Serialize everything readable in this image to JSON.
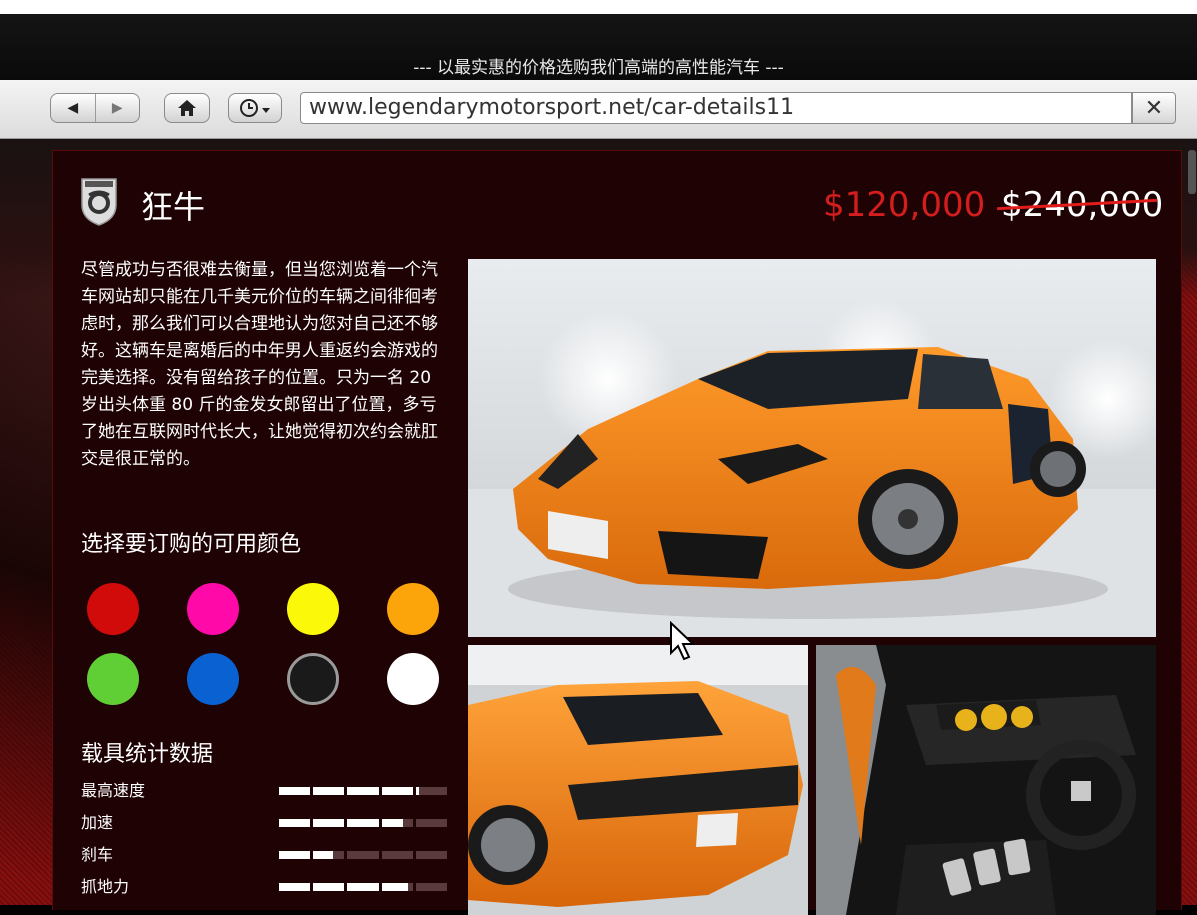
{
  "window": {
    "tagline": "--- 以最实惠的价格选购我们高端的高性能汽车 ---"
  },
  "toolbar": {
    "back_icon": "back-arrow-icon",
    "forward_icon": "forward-arrow-icon",
    "home_icon": "home-icon",
    "history_icon": "clock-icon",
    "url": "www.legendarymotorsport.net/car-details11",
    "close_label": "✕"
  },
  "vehicle": {
    "brand_icon": "pegassi-logo-icon",
    "name": "狂牛",
    "sale_price": "$120,000",
    "original_price": "$240,000",
    "description": "尽管成功与否很难去衡量，但当您浏览着一个汽车网站却只能在几千美元价位的车辆之间徘徊考虑时，那么我们可以合理地认为您对自己还不够好。这辆车是离婚后的中年男人重返约会游戏的完美选择。没有留给孩子的位置。只为一名 20 岁出头体重 80 斤的金发女郎留出了位置，多亏了她在互联网时代长大，让她觉得初次约会就肛交是很正常的。"
  },
  "colors": {
    "title": "选择要订购的可用颜色",
    "options": [
      {
        "name": "red",
        "hex": "#d10a0a"
      },
      {
        "name": "pink",
        "hex": "#ff0aa8"
      },
      {
        "name": "yellow",
        "hex": "#fcf80a"
      },
      {
        "name": "orange",
        "hex": "#fca50a"
      },
      {
        "name": "green",
        "hex": "#60cf35"
      },
      {
        "name": "blue",
        "hex": "#0a62d2"
      },
      {
        "name": "black",
        "hex": "#1a1a1a"
      },
      {
        "name": "white",
        "hex": "#ffffff"
      }
    ]
  },
  "stats": {
    "title": "载具统计数据",
    "items": [
      {
        "label": "最高速度",
        "value": 0.82
      },
      {
        "label": "加速",
        "value": 0.74
      },
      {
        "label": "刹车",
        "value": 0.33
      },
      {
        "label": "抓地力",
        "value": 0.77
      }
    ]
  }
}
